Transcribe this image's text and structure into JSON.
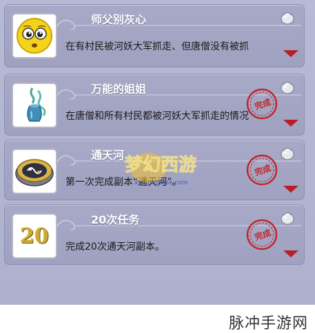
{
  "quests": [
    {
      "title": "师父别灰心",
      "description": "在有村民被河妖大军抓走、但唐僧没有被抓",
      "icon": "crying-face-icon",
      "completed": false
    },
    {
      "title": "万能的姐姐",
      "description": "在唐僧和所有村民都被河妖大军抓走的情况",
      "icon": "jade-vase-icon",
      "completed": true,
      "stamp_text": "完成"
    },
    {
      "title": "通天河",
      "description": "第一次完成副本“通天河”。",
      "icon": "yin-yang-medallion-icon",
      "completed": true,
      "stamp_text": "完成"
    },
    {
      "title": "20次任务",
      "description": "完成20次通天河副本。",
      "icon": "number-20-icon",
      "icon_text": "20",
      "completed": true,
      "stamp_text": "完成"
    }
  ],
  "watermarks": {
    "game_logo_text": "梦幻西游",
    "game_logo_url_text": "xyq.netease.com",
    "corner_text": "脉冲手游网"
  },
  "colors": {
    "panel_bg": "#b7b9d5",
    "card_bg": "#a7a9c7",
    "arrow": "#b91e23",
    "stamp": "#c0262b",
    "title_text": "#ffffff"
  }
}
